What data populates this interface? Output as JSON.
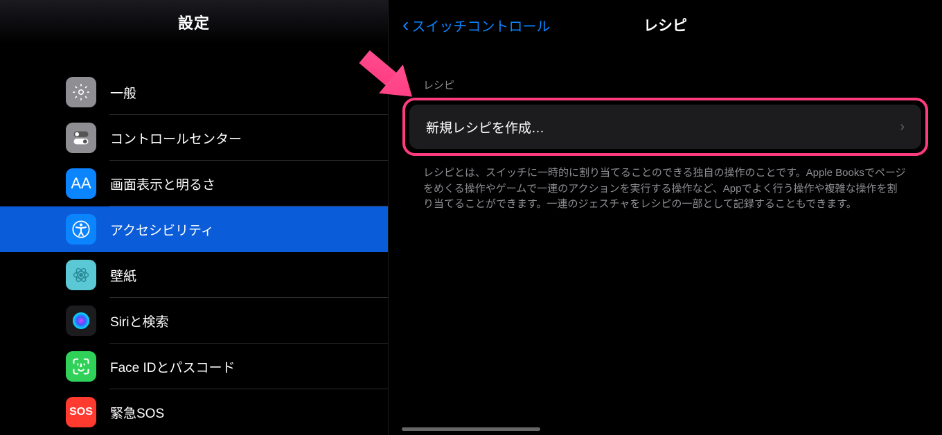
{
  "sidebar": {
    "title": "設定",
    "items": [
      {
        "label": "一般",
        "icon": "gear"
      },
      {
        "label": "コントロールセンター",
        "icon": "toggle"
      },
      {
        "label": "画面表示と明るさ",
        "icon": "aa"
      },
      {
        "label": "アクセシビリティ",
        "icon": "accessibility",
        "selected": true
      },
      {
        "label": "壁紙",
        "icon": "flower"
      },
      {
        "label": "Siriと検索",
        "icon": "siri"
      },
      {
        "label": "Face IDとパスコード",
        "icon": "faceid"
      },
      {
        "label": "緊急SOS",
        "icon": "sos"
      }
    ]
  },
  "detail": {
    "back_label": "スイッチコントロール",
    "title": "レシピ",
    "section_label": "レシピ",
    "create_label": "新規レシピを作成…",
    "footer_text": "レシピとは、スイッチに一時的に割り当てることのできる独自の操作のことです。Apple Booksでページをめくる操作やゲームで一連のアクションを実行する操作など、Appでよく行う操作や複雑な操作を割り当てることができます。一連のジェスチャをレシピの一部として記録することもできます。"
  },
  "icons": {
    "aa_text": "AA",
    "sos_text": "SOS"
  }
}
